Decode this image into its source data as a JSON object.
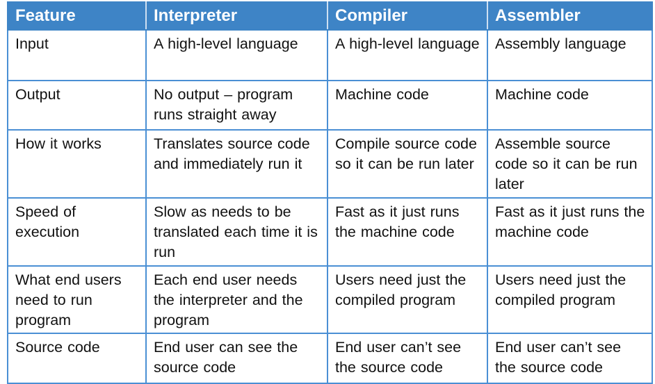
{
  "table": {
    "headers": [
      "Feature",
      "Interpreter",
      "Compiler",
      "Assembler"
    ],
    "rows": [
      [
        "Input",
        "A high-level language",
        "A high-level language",
        "Assembly language"
      ],
      [
        "Output",
        "No output – program runs straight away",
        "Machine code",
        "Machine code"
      ],
      [
        "How it works",
        "Translates source code and immediately run it",
        "Compile source code so it can be run later",
        "Assemble source code so it can be run later"
      ],
      [
        "Speed of execution",
        "Slow as needs to be translated each time it is run",
        "Fast as it just runs the machine code",
        "Fast as it just runs the machine code"
      ],
      [
        "What end users need to run program",
        "Each end user needs the interpreter and the program",
        "Users need just the compiled program",
        "Users need just the compiled program"
      ],
      [
        "Source code",
        "End user can see the source code",
        "End user can’t see the source code",
        "End user can’t see the source code"
      ]
    ]
  },
  "colors": {
    "header_background": "#3e84c6",
    "header_text": "#ffffff",
    "border": "#4a8fd4",
    "body_text": "#111111"
  }
}
